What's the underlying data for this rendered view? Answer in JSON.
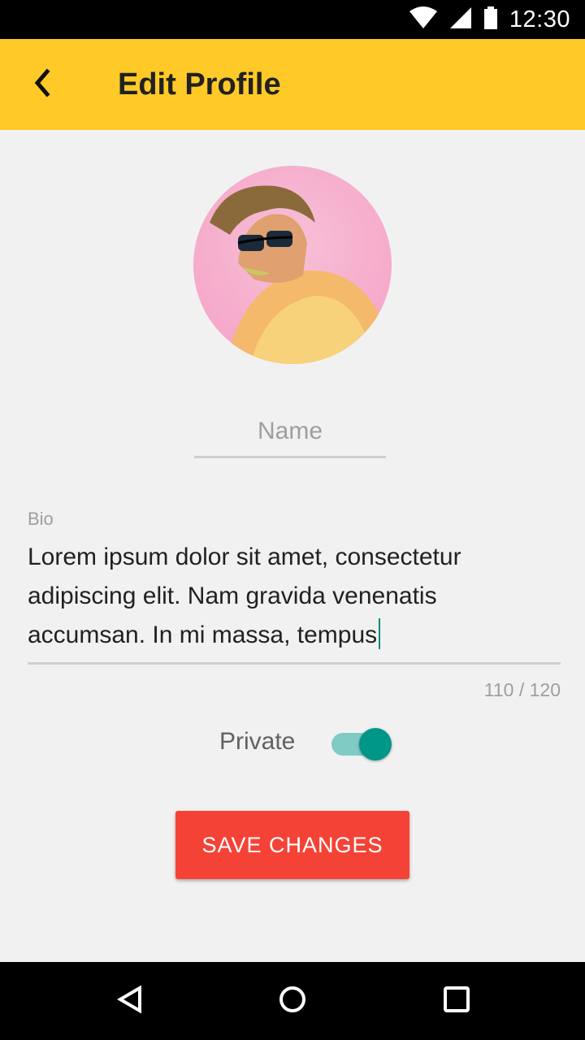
{
  "status_bar": {
    "time": "12:30",
    "icons": [
      "wifi-icon",
      "signal-icon",
      "battery-icon"
    ]
  },
  "app_bar": {
    "title": "Edit Profile",
    "back_icon": "back-arrow-icon",
    "background_color": "#ffca28"
  },
  "profile": {
    "avatar": "profile-photo"
  },
  "name_field": {
    "value": "",
    "placeholder": "Name"
  },
  "bio": {
    "label": "Bio",
    "value": "Lorem ipsum dolor sit amet, consectetur adipiscing elit. Nam gravida venenatis accumsan. In mi massa, tempus",
    "counter": "110 / 120"
  },
  "privacy": {
    "label": "Private",
    "enabled": true,
    "accent_color": "#009688"
  },
  "actions": {
    "save_label": "SAVE CHANGES",
    "save_color": "#f44336"
  },
  "nav_bar": {
    "icons": [
      "back-triangle-icon",
      "home-circle-icon",
      "recents-square-icon"
    ]
  }
}
